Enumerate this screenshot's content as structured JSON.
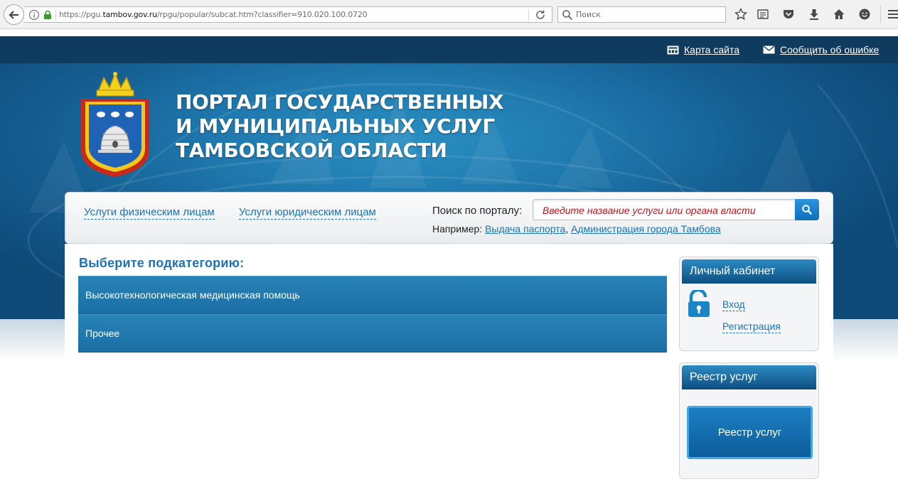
{
  "browser": {
    "url_prefix": "https://pgu.",
    "url_host": "tambov.gov.ru",
    "url_path": "/rpgu/popular/subcat.htm?classifier=910.020.100.0720",
    "search_placeholder": "Поиск"
  },
  "topbar": {
    "sitemap": "Карта сайта",
    "report_error": "Сообщить об ошибке"
  },
  "header": {
    "title_line1": "ПОРТАЛ ГОСУДАРСТВЕННЫХ",
    "title_line2": "И МУНИЦИПАЛЬНЫХ УСЛУГ",
    "title_line3": "ТАМБОВСКОЙ ОБЛАСТИ"
  },
  "nav": {
    "individuals": "Услуги физическим лицам",
    "legal": "Услуги юридическим лицам",
    "search_label": "Поиск по порталу:",
    "search_placeholder": "Введите название услуги или органа власти",
    "example_label": "Например:",
    "example1": "Выдача паспорта",
    "example_sep": ",",
    "example2": "Администрация города Тамбова"
  },
  "main": {
    "heading": "Выберите подкатегорию:",
    "categories": [
      "Высокотехнологическая медицинская помощь",
      "Прочее"
    ]
  },
  "cabinet": {
    "title": "Личный кабинет",
    "login": "Вход",
    "register": "Регистрация"
  },
  "registry": {
    "title": "Реестр услуг",
    "button": "Реестр услуг"
  },
  "colors": {
    "topbar": "#0e3b5e",
    "accent": "#1b73b5",
    "category_bg": "#2179ae",
    "search_placeholder": "#c0141c"
  }
}
